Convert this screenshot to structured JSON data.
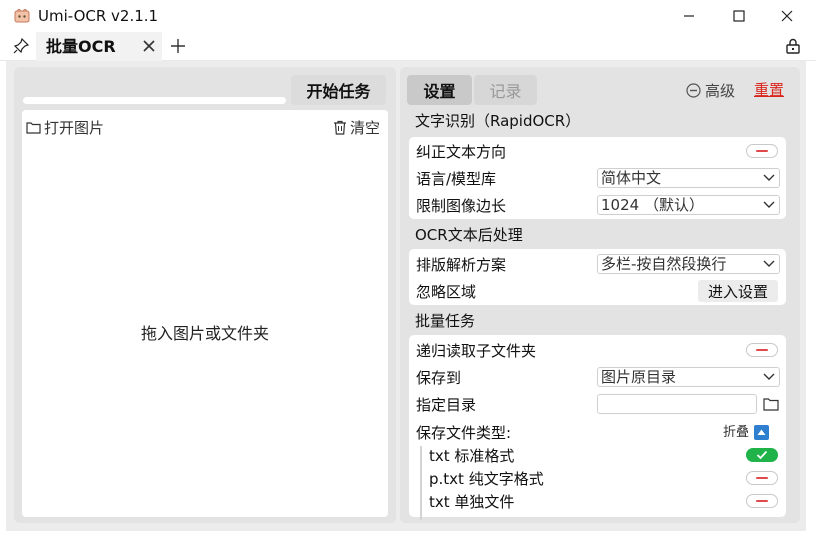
{
  "window": {
    "title": "Umi-OCR v2.1.1",
    "controls": {
      "minimize_icon": "minimize-icon",
      "maximize_icon": "maximize-icon",
      "close_icon": "close-icon"
    }
  },
  "tabbar": {
    "tabs": [
      {
        "label": "批量OCR",
        "active": true
      }
    ]
  },
  "left": {
    "start_button": "开始任务",
    "progress": 0,
    "open_image": "打开图片",
    "clear": "清空",
    "drop_hint": "拖入图片或文件夹"
  },
  "right": {
    "tabs": {
      "settings": "设置",
      "records": "记录"
    },
    "advanced": "高级",
    "reset": "重置",
    "sections": {
      "ocr": {
        "title": "文字识别（RapidOCR）",
        "correct_direction": {
          "label": "纠正文本方向",
          "value": false
        },
        "language": {
          "label": "语言/模型库",
          "value": "简体中文"
        },
        "limit_side": {
          "label": "限制图像边长",
          "value": "1024 （默认）"
        }
      },
      "post": {
        "title": "OCR文本后处理",
        "layout": {
          "label": "排版解析方案",
          "value": "多栏-按自然段换行"
        },
        "ignore_area": {
          "label": "忽略区域",
          "button": "进入设置"
        }
      },
      "batch": {
        "title": "批量任务",
        "recursive": {
          "label": "递归读取子文件夹",
          "value": false
        },
        "save_to": {
          "label": "保存到",
          "value": "图片原目录"
        },
        "dir": {
          "label": "指定目录",
          "value": ""
        },
        "file_types": {
          "label": "保存文件类型:",
          "fold": "折叠",
          "items": [
            {
              "label": "txt 标准格式",
              "value": true
            },
            {
              "label": "p.txt 纯文字格式",
              "value": false
            },
            {
              "label": "txt 单独文件",
              "value": false
            }
          ]
        }
      }
    }
  },
  "colors": {
    "accent": "#4a8fd9",
    "toggle_on": "#1fb34a",
    "toggle_off_mark": "#e04a4a",
    "reset": "#d9261c"
  }
}
